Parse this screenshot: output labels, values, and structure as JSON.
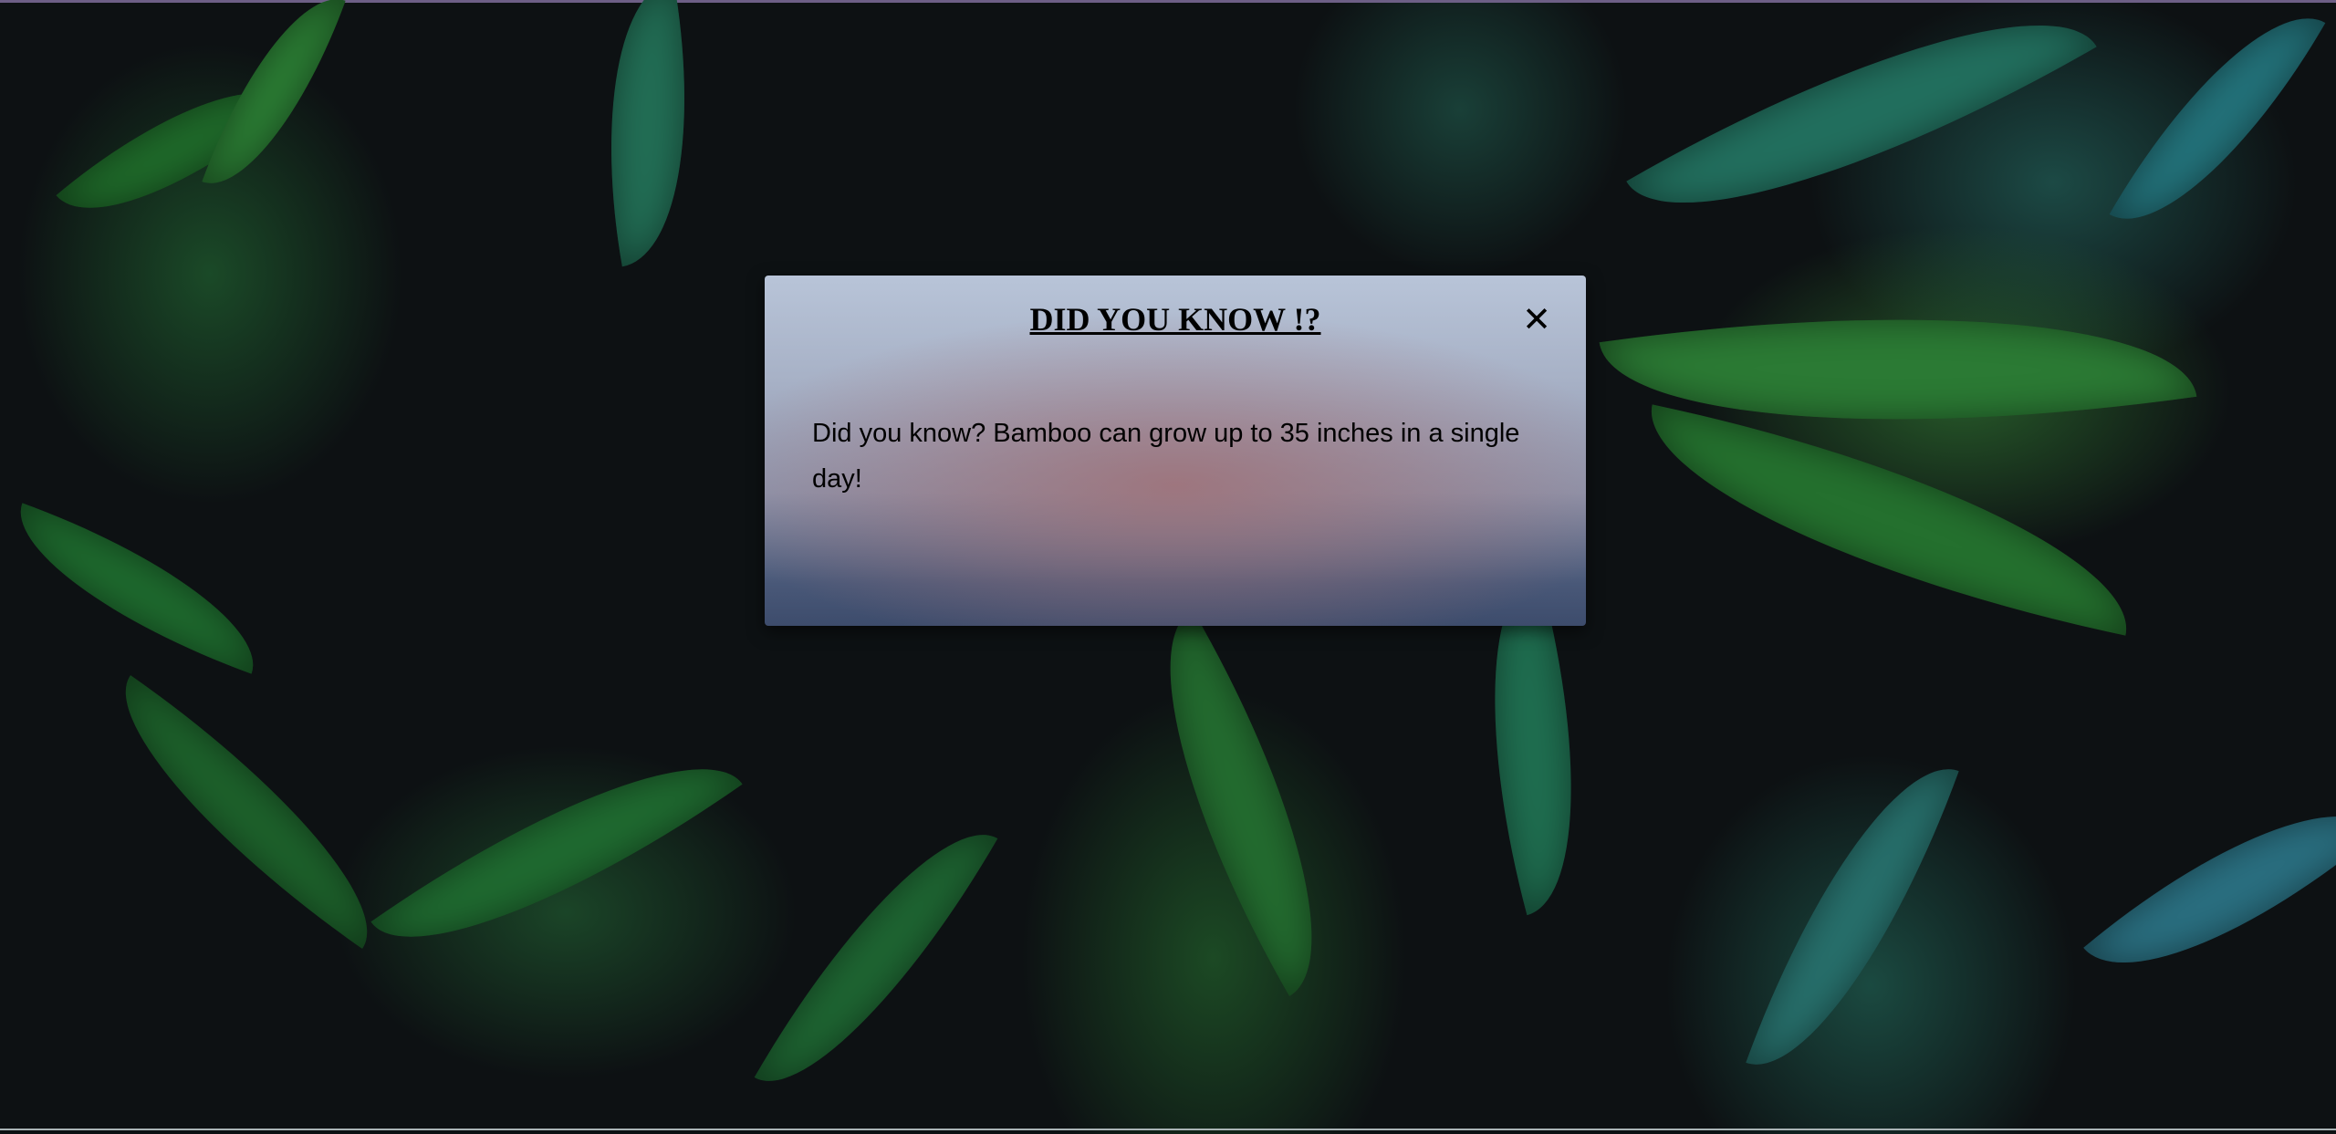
{
  "modal": {
    "title": "DID YOU KNOW !?",
    "close_icon": "close-icon",
    "close_symbol": "✕",
    "message": "Did you know? Bamboo can grow up to 35 inches in a single day!"
  },
  "background": {
    "description": "dark green leaves",
    "base_color": "#0d1113",
    "leaf_green": "#2f7d3a",
    "leaf_teal": "#2e7f7a"
  }
}
